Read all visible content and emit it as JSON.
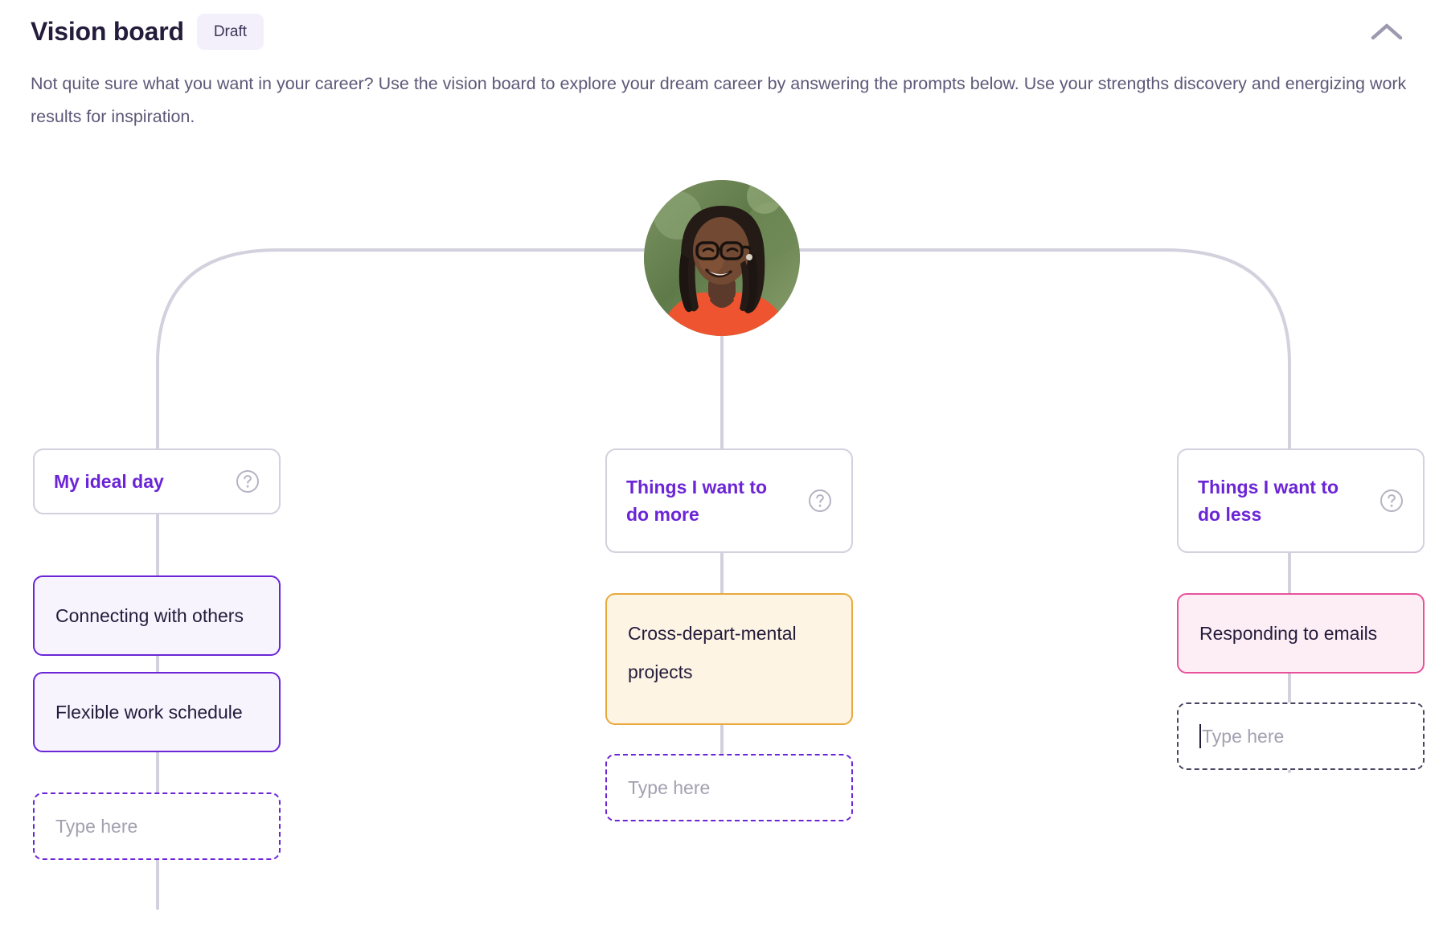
{
  "header": {
    "title": "Vision board",
    "status_badge": "Draft",
    "collapse_icon": "chevron-up-icon",
    "collapse_label": "Collapse section"
  },
  "description": "Not quite sure what you want in your career? Use the vision board to explore your dream career by answering the prompts below. Use your strengths discovery and energizing work results for inspiration.",
  "avatar": {
    "name": "user-avatar",
    "alt": "Smiling person with glasses and braided hair wearing an orange shirt outdoors"
  },
  "colors": {
    "accent_purple": "#6b25d6",
    "title_ink": "#241c3b",
    "body_text": "#5d5878",
    "connector": "#d3d1dd",
    "badge_bg": "#f3f0fb",
    "card_purple_bg": "#f7f4fe",
    "card_purple_border": "#6b25d6",
    "card_yellow_bg": "#fdf4e4",
    "card_yellow_border": "#e9a93c",
    "card_pink_bg": "#fdeef6",
    "card_pink_border": "#e8529b",
    "placeholder_text": "#a3a1b0"
  },
  "columns": [
    {
      "id": "ideal-day",
      "prompt": "My ideal day",
      "help_icon": "help-circle-icon",
      "items": [
        {
          "text": "Connecting with others",
          "style": "purple"
        },
        {
          "text": "Flexible work schedule",
          "style": "purple"
        }
      ],
      "input": {
        "placeholder": "Type here",
        "value": "",
        "focused": false,
        "border": "dashed-purple"
      }
    },
    {
      "id": "do-more",
      "prompt": "Things I want to do more",
      "help_icon": "help-circle-icon",
      "items": [
        {
          "text": "Cross-depart-mental projects",
          "style": "yellow"
        }
      ],
      "input": {
        "placeholder": "Type here",
        "value": "",
        "focused": false,
        "border": "dashed-purple"
      }
    },
    {
      "id": "do-less",
      "prompt": "Things I want to do less",
      "help_icon": "help-circle-icon",
      "items": [
        {
          "text": "Responding to emails",
          "style": "pink"
        }
      ],
      "input": {
        "placeholder": "Type here",
        "value": "",
        "focused": true,
        "border": "dashed-gray"
      }
    }
  ]
}
